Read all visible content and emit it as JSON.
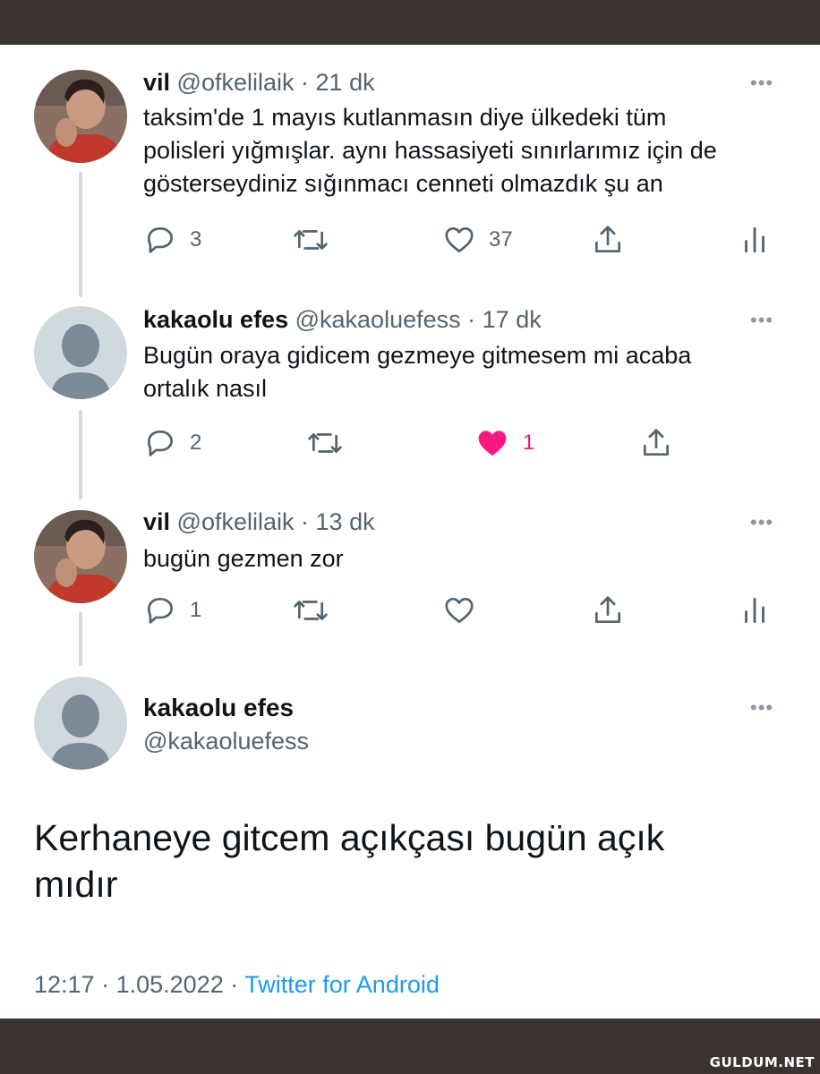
{
  "tweets": [
    {
      "name": "vil",
      "handle": "@ofkelilaik",
      "separator": "·",
      "time": "21 dk",
      "text_lines": [
        "taksim'de 1 mayıs kutlanmasın diye ülkedeki tüm",
        "polisleri yığmışlar. aynı hassasiyeti sınırlarımız için de",
        "gösterseydiniz sığınmacı cenneti olmazdık şu an"
      ],
      "replies": "3",
      "likes": "37"
    },
    {
      "name": "kakaolu efes",
      "handle": "@kakaoluefess",
      "separator": "·",
      "time": "17 dk",
      "text_lines": [
        "Bugün oraya gidicem gezmeye gitmesem mi acaba",
        "ortalık nasıl"
      ],
      "replies": "2",
      "likes": "1"
    },
    {
      "name": "vil",
      "handle": "@ofkelilaik",
      "separator": "·",
      "time": "13 dk",
      "text_lines": [
        "bugün gezmen zor"
      ],
      "replies": "1",
      "likes": ""
    }
  ],
  "main_tweet": {
    "name": "kakaolu efes",
    "handle": "@kakaoluefess",
    "text_lines": [
      "Kerhaneye gitcem açıkçası bugün açık",
      "mıdır"
    ],
    "time": "12:17",
    "date": "1.05.2022",
    "separator": "·",
    "source": "Twitter for Android"
  },
  "more_glyph": "•••",
  "watermark": "GULDUM.NET",
  "colors": {
    "like_active": "#f91880",
    "link": "#1d9bf0",
    "muted": "#536471",
    "thread_line": "#cfd9de"
  }
}
